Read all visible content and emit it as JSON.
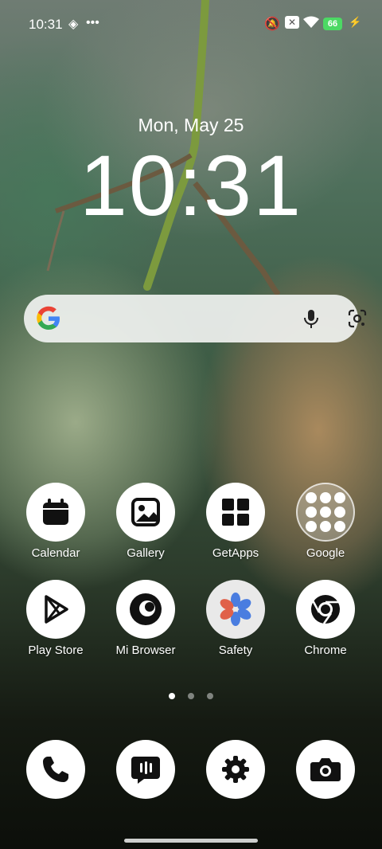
{
  "status": {
    "time": "10:31",
    "battery": "66"
  },
  "lockscreen": {
    "date": "Mon, May 25",
    "clock": "10:31"
  },
  "apps_row1": [
    {
      "label": "Calendar"
    },
    {
      "label": "Gallery"
    },
    {
      "label": "GetApps"
    },
    {
      "label": "Google"
    }
  ],
  "apps_row2": [
    {
      "label": "Play Store"
    },
    {
      "label": "Mi Browser"
    },
    {
      "label": "Safety"
    },
    {
      "label": "Chrome"
    }
  ],
  "colors": {
    "battery": "#4cd964",
    "google_blue": "#4285F4",
    "google_red": "#EA4335",
    "google_yellow": "#FBBC05",
    "google_green": "#34A853"
  },
  "pager": {
    "pages": 3,
    "active": 1
  }
}
